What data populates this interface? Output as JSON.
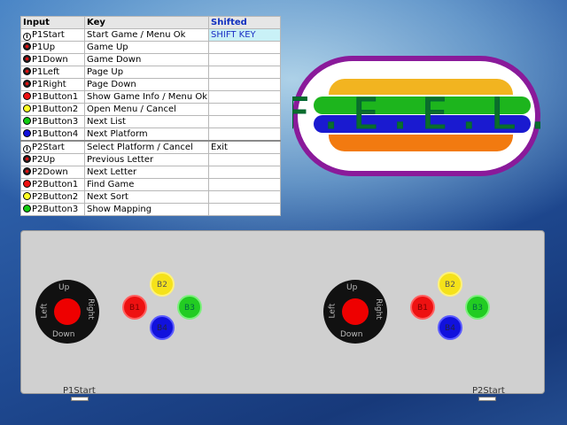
{
  "table": {
    "headers": {
      "input": "Input",
      "key": "Key",
      "shifted": "Shifted"
    },
    "rows": [
      {
        "input": "P1Start",
        "key": "Start Game / Menu Ok",
        "shifted": "SHIFT KEY"
      },
      {
        "input": "P1Up",
        "key": "Game Up",
        "shifted": ""
      },
      {
        "input": "P1Down",
        "key": "Game Down",
        "shifted": ""
      },
      {
        "input": "P1Left",
        "key": "Page Up",
        "shifted": ""
      },
      {
        "input": "P1Right",
        "key": "Page Down",
        "shifted": ""
      },
      {
        "input": "P1Button1",
        "key": "Show Game Info / Menu Ok",
        "shifted": ""
      },
      {
        "input": "P1Button2",
        "key": "Open Menu / Cancel",
        "shifted": ""
      },
      {
        "input": "P1Button3",
        "key": "Next List",
        "shifted": ""
      },
      {
        "input": "P1Button4",
        "key": "Next Platform",
        "shifted": ""
      },
      {
        "input": "P2Start",
        "key": "Select Platform / Cancel",
        "shifted": "Exit"
      },
      {
        "input": "P2Up",
        "key": "Previous Letter",
        "shifted": ""
      },
      {
        "input": "P2Down",
        "key": "Next Letter",
        "shifted": ""
      },
      {
        "input": "P2Button1",
        "key": "Find Game",
        "shifted": ""
      },
      {
        "input": "P2Button2",
        "key": "Next Sort",
        "shifted": ""
      },
      {
        "input": "P2Button3",
        "key": "Show Mapping",
        "shifted": ""
      }
    ]
  },
  "logo": {
    "text": "F.E.E.L."
  },
  "panel": {
    "joystick_labels": {
      "up": "Up",
      "down": "Down",
      "left": "Left",
      "right": "Right"
    },
    "buttons": {
      "b1": "B1",
      "b2": "B2",
      "b3": "B3",
      "b4": "B4"
    },
    "p1_start": "P1Start",
    "p2_start": "P2Start"
  },
  "colors": {
    "shift_key_bg": "#c9f1f7",
    "shifted_header": "#1030c0",
    "logo_ring": "#8a1a9a",
    "logo_band_yellow": "#f2b420",
    "logo_band_green": "#1db51d",
    "logo_band_blue": "#1a1ad0",
    "logo_band_orange": "#f27a10",
    "panel_bg": "#d0d0d0"
  }
}
